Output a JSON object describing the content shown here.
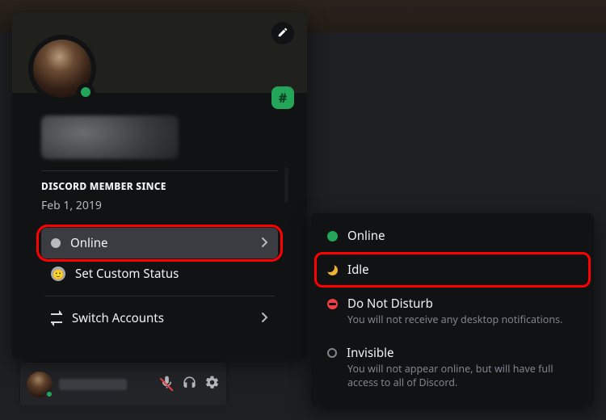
{
  "profile": {
    "member_since_label": "DISCORD MEMBER SINCE",
    "member_since_value": "Feb 1, 2019"
  },
  "menu": {
    "online_label": "Online",
    "custom_status_label": "Set Custom Status",
    "switch_accounts_label": "Switch Accounts"
  },
  "status_options": {
    "online": {
      "label": "Online"
    },
    "idle": {
      "label": "Idle"
    },
    "dnd": {
      "label": "Do Not Disturb",
      "desc": "You will not receive any desktop notifications."
    },
    "invisible": {
      "label": "Invisible",
      "desc": "You will not appear online, but will have full access to all of Discord."
    }
  },
  "colors": {
    "online": "#23a55a",
    "idle": "#f0b232",
    "dnd": "#f23f43",
    "offline": "#80848e",
    "highlight": "#ff0000"
  }
}
